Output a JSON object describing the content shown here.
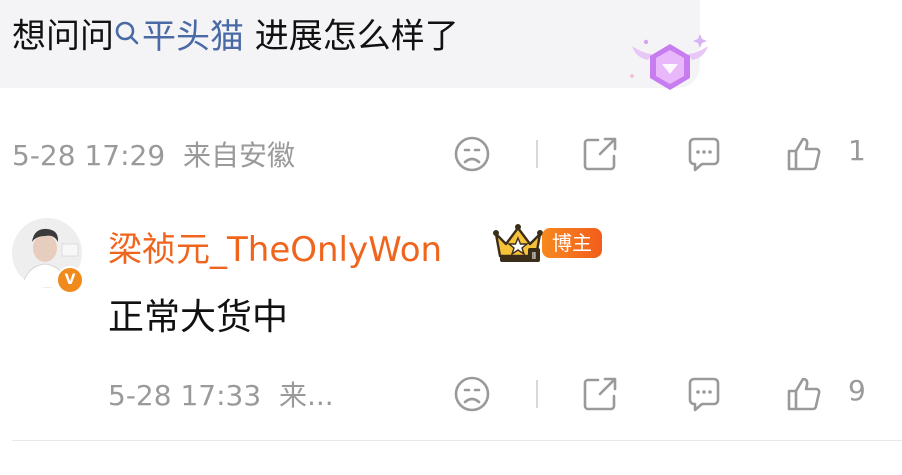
{
  "comment": {
    "text_before": "想问问",
    "topic_name": "平头猫",
    "text_after": " 进展怎么样了",
    "time": "5-28 17:29",
    "location": "来自安徽",
    "like_count": "1",
    "icons": [
      "sad-face-icon",
      "share-icon",
      "comment-icon",
      "thumbs-up-icon"
    ]
  },
  "reply": {
    "username": "梁祯元_TheOnlyWon",
    "badge": "博主",
    "verified_mark": "V",
    "text": "正常大货中",
    "time": "5-28 17:33",
    "location_truncated": "来...",
    "like_count": "9"
  },
  "colors": {
    "username": "#f0651d",
    "topic": "#4a6aa6",
    "meta_gray": "#9a9a9a",
    "bubble_bg": "#f4f4f6",
    "badge_orange": "#f7891f"
  }
}
